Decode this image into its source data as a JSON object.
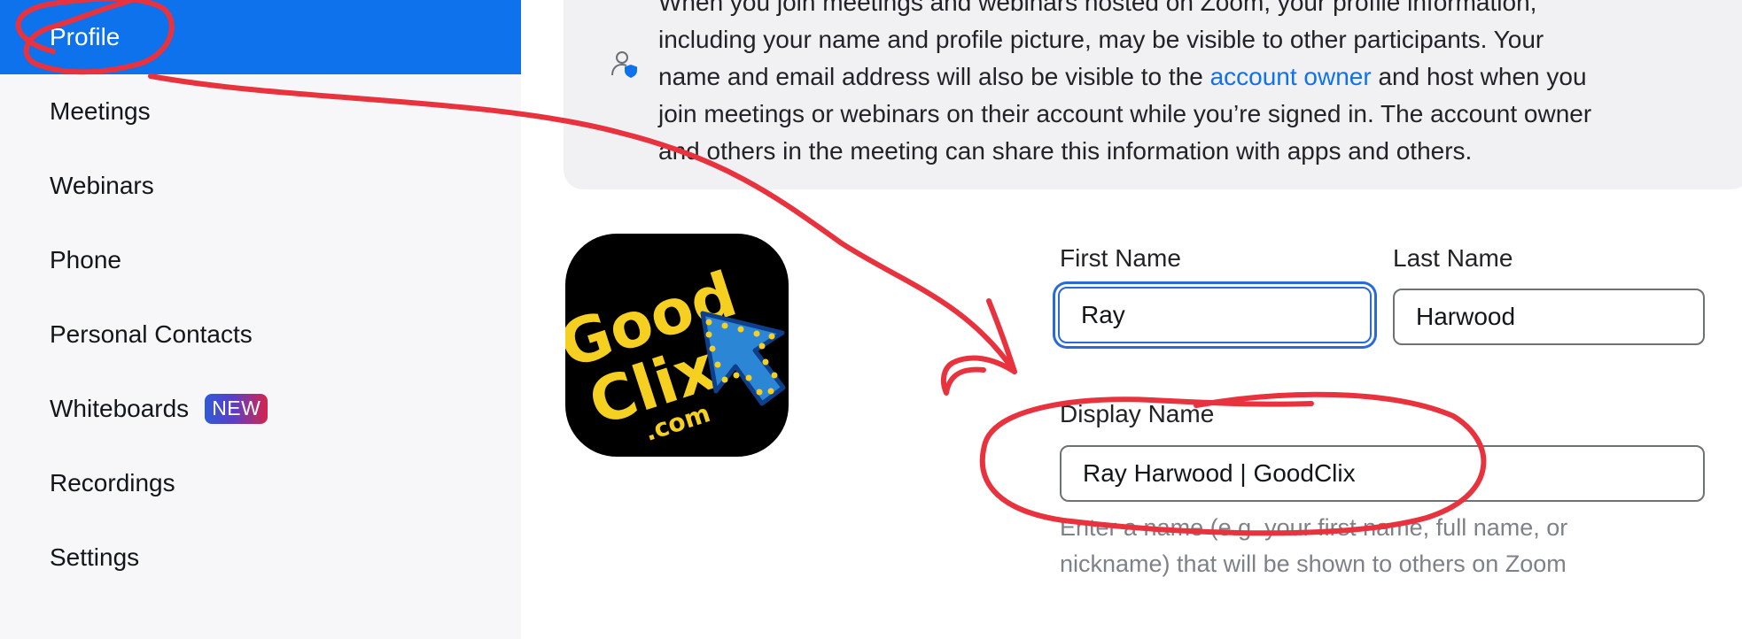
{
  "sidebar": {
    "items": [
      {
        "label": "Profile",
        "active": true
      },
      {
        "label": "Meetings"
      },
      {
        "label": "Webinars"
      },
      {
        "label": "Phone"
      },
      {
        "label": "Personal Contacts"
      },
      {
        "label": "Whiteboards",
        "badge": "NEW"
      },
      {
        "label": "Recordings"
      },
      {
        "label": "Settings"
      }
    ]
  },
  "info": {
    "line1": "When you join meetings and webinars hosted on Zoom, your profile information,",
    "line2": "including your name and profile picture, may be visible to other participants. Your",
    "line3_before": "name and email address will also be visible to the ",
    "link": "account owner",
    "line3_after": " and host when you",
    "line4": "join meetings or webinars on their account while you’re signed in. The account owner",
    "line5": "and others in the meeting can share this information with apps and others."
  },
  "profile": {
    "logo_text_1": "Good",
    "logo_text_2": "Clix",
    "logo_text_3": ".com"
  },
  "form": {
    "first_name_label": "First Name",
    "first_name_value": "Ray",
    "last_name_label": "Last Name",
    "last_name_value": "Harwood",
    "display_name_label": "Display Name",
    "display_name_value": "Ray Harwood | GoodClix",
    "display_name_hint_1": "Enter a name (e.g. your first name, full name, or",
    "display_name_hint_2": "nickname) that will be shown to others on Zoom"
  },
  "colors": {
    "accent": "#0e72ed",
    "annotation": "#e8323e"
  }
}
